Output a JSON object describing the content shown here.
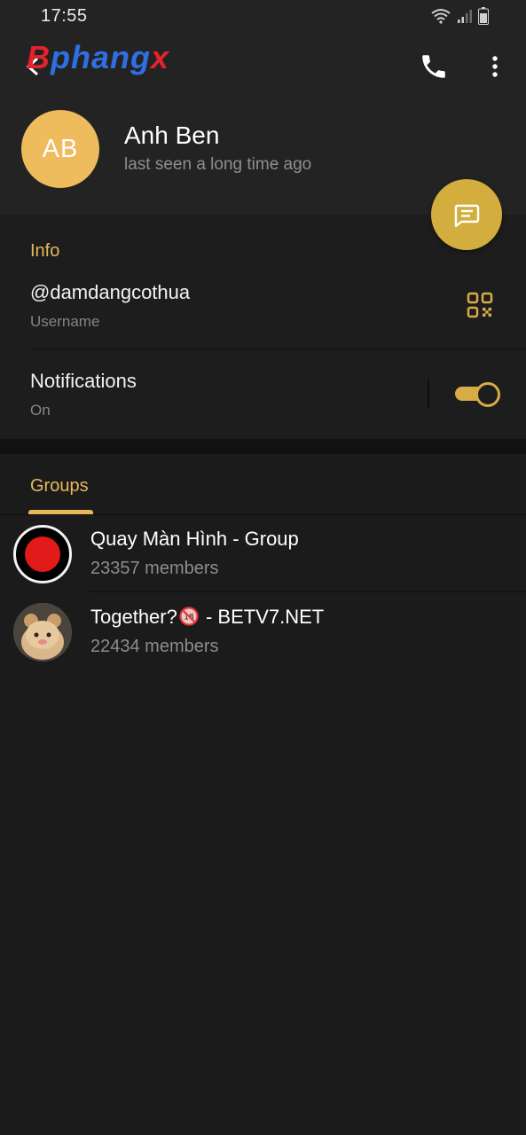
{
  "status_bar": {
    "time": "17:55"
  },
  "header": {
    "logo_parts": [
      "B",
      "phang",
      "x"
    ]
  },
  "profile": {
    "initials": "AB",
    "name": "Anh Ben",
    "status": "last seen a long time ago",
    "avatar_color": "#eebb5d"
  },
  "info": {
    "title": "Info",
    "username": "@damdangcothua",
    "username_label": "Username",
    "notifications_label": "Notifications",
    "notifications_value": "On",
    "notifications_enabled": true
  },
  "tabs": {
    "groups_label": "Groups"
  },
  "groups": [
    {
      "name": "Quay Màn Hình - Group",
      "members": "23357 members",
      "avatar": "record-icon"
    },
    {
      "name_before": "Together?",
      "name_after": " - BETV7.NET",
      "name_icon": "no-under-18-icon",
      "members": "22434 members",
      "avatar": "cat-photo"
    }
  ],
  "colors": {
    "accent": "#e7b85a",
    "fab": "#d4ad3f",
    "background": "#1b1b1b"
  }
}
